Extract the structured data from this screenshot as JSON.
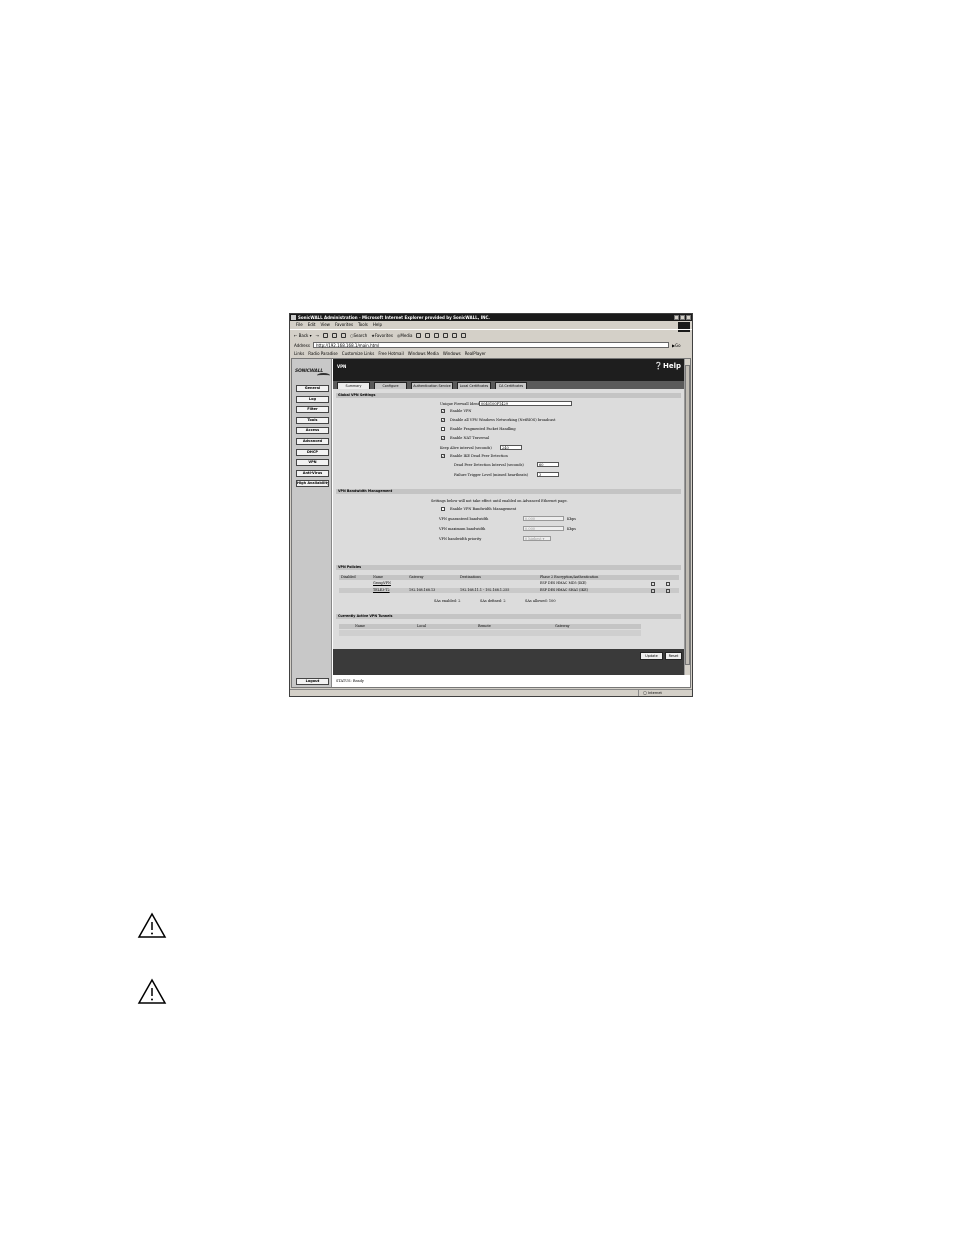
{
  "window": {
    "title": "SonicWALL Administration - Microsoft Internet Explorer provided by SonicWALL, INC.",
    "menu": [
      "File",
      "Edit",
      "View",
      "Favorites",
      "Tools",
      "Help"
    ],
    "toolbar": {
      "back": "Back",
      "search": "Search",
      "favorites": "Favorites",
      "media": "Media"
    },
    "address_label": "Address",
    "address": "http://192.168.168.1/main.html",
    "go": "Go",
    "links_label": "Links",
    "links": [
      "Radio Paradise",
      "Customize Links",
      "Free Hotmail",
      "Windows Media",
      "Windows",
      "RealPlayer"
    ],
    "status_bar": "",
    "zone": "Internet"
  },
  "sidebar": {
    "logo": "SONICWALL",
    "items": [
      "General",
      "Log",
      "Filter",
      "Tools",
      "Access",
      "Advanced",
      "DHCP",
      "VPN",
      "Anti-Virus",
      "High Availability"
    ],
    "logout": "Logout"
  },
  "header": {
    "page": "VPN",
    "help": "Help"
  },
  "tabs": [
    "Summary",
    "Configure",
    "Authentication Service",
    "Local Certificates",
    "CA Certificates"
  ],
  "global": {
    "title": "Global VPN Settings",
    "unique_id_label": "Unique Firewall Identifier",
    "unique_id": "0040100F1429",
    "enable_vpn": "Enable VPN",
    "netbios": "Disable all VPN Windows Networking (NetBIOS) broadcast",
    "fragmented": "Enable Fragmented Packet Handling",
    "nat": "Enable NAT Traversal",
    "keepalive_label": "Keep Alive interval (seconds)",
    "keepalive": "240",
    "dpd": "Enable IKE Dead Peer Detection",
    "dpd_interval_label": "Dead Peer Detection Interval (seconds)",
    "dpd_interval": "60",
    "failure_label": "Failure Trigger Level (missed heartbeats)",
    "failure": "3"
  },
  "bandwidth": {
    "title": "VPN Bandwidth Management",
    "note": "Settings below will not take effect until enabled on Advanced Ethernet page.",
    "enable": "Enable VPN Bandwidth Management",
    "guaranteed_label": "VPN guaranteed bandwidth",
    "guaranteed": "0.000",
    "maximum_label": "VPN maximum bandwidth",
    "maximum": "0.000",
    "unit": "Kbps",
    "priority_label": "VPN bandwidth priority",
    "priority": "0 highest"
  },
  "policies": {
    "title": "VPN Policies",
    "columns": [
      "Disabled",
      "Name",
      "Gateway",
      "Destinations",
      "Phase 2 Encryption/Authentication"
    ],
    "rows": [
      {
        "name": "GroupVPN",
        "gateway": "",
        "destinations": "",
        "phase2": "ESP DES HMAC MD5 (IKE)"
      },
      {
        "name": "TELE3-T2",
        "gateway": "192.168.168.13",
        "destinations": "192.168.11.1 - 192.168.1.255",
        "phase2": "ESP DES HMAC SHA1 (IKE)"
      }
    ],
    "sas_enabled": "SAs enabled: 2",
    "sas_defined": "SAs defined: 2",
    "sas_allowed": "SAs allowed: 100"
  },
  "tunnels": {
    "title": "Currently Active VPN Tunnels",
    "columns": [
      "Name",
      "Local",
      "Remote",
      "Gateway"
    ]
  },
  "buttons": {
    "update": "Update",
    "reset": "Reset"
  },
  "status": "STATUS: Ready"
}
